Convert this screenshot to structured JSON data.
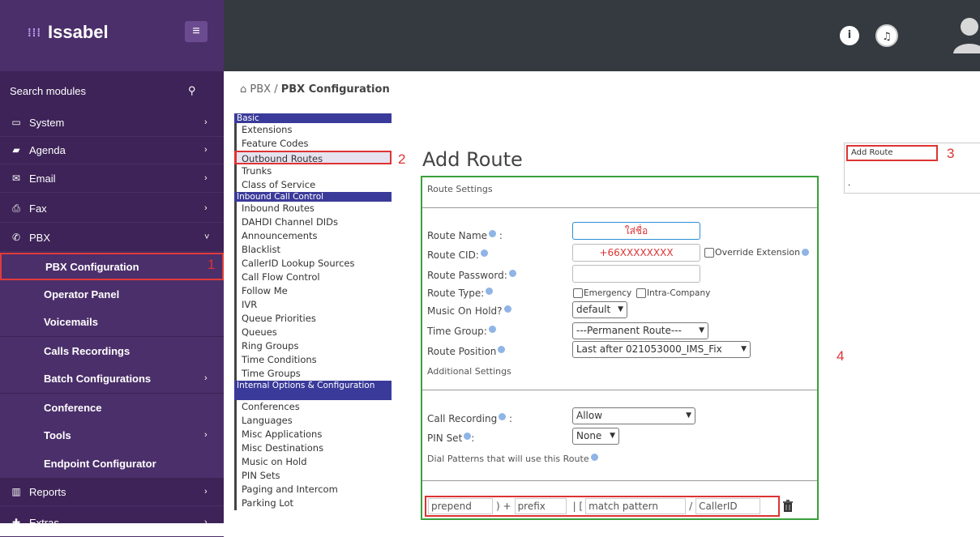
{
  "sidebar": {
    "brand": "Issabel",
    "search_label": "Search modules",
    "items": [
      {
        "label": "System",
        "icon": "monitor-icon",
        "chevron": "›"
      },
      {
        "label": "Agenda",
        "icon": "book-icon",
        "chevron": "›"
      },
      {
        "label": "Email",
        "icon": "envelope-icon",
        "chevron": "›"
      },
      {
        "label": "Fax",
        "icon": "printer-icon",
        "chevron": "›"
      },
      {
        "label": "PBX",
        "icon": "phone-icon",
        "chevron": "˅"
      },
      {
        "label": "PBX Configuration"
      },
      {
        "label": "Operator Panel"
      },
      {
        "label": "Voicemails"
      },
      {
        "label": "Calls Recordings"
      },
      {
        "label": "Batch Configurations",
        "chevron": "›"
      },
      {
        "label": "Conference"
      },
      {
        "label": "Tools",
        "chevron": "›"
      },
      {
        "label": "Endpoint Configurator"
      },
      {
        "label": "Reports",
        "icon": "bar-chart-icon",
        "chevron": "›"
      },
      {
        "label": "Extras",
        "icon": "plus-icon",
        "chevron": "›"
      }
    ]
  },
  "markers": {
    "m1": "1",
    "m2": "2",
    "m3": "3",
    "m4": "4"
  },
  "topbar": {
    "info_glyph": "i",
    "bell_glyph": "♫"
  },
  "breadcrumb": {
    "home_glyph": "⌂",
    "pbx": "PBX",
    "sep": "/",
    "current": "PBX Configuration"
  },
  "pbx_menu": {
    "basic": "Basic",
    "basic_items": [
      "Extensions",
      "Feature Codes",
      "Outbound Routes",
      "Trunks",
      "Class of Service"
    ],
    "inbound": "Inbound Call Control",
    "inbound_items": [
      "Inbound Routes",
      "DAHDI Channel DIDs",
      "Announcements",
      "Blacklist",
      "CallerID Lookup Sources",
      "Call Flow Control",
      "Follow Me",
      "IVR",
      "Queue Priorities",
      "Queues",
      "Ring Groups",
      "Time Conditions",
      "Time Groups"
    ],
    "internal": "Internal Options & Configuration",
    "internal_items": [
      "Conferences",
      "Languages",
      "Misc Applications",
      "Misc Destinations",
      "Music on Hold",
      "PIN Sets",
      "Paging and Intercom",
      "Parking Lot"
    ]
  },
  "form": {
    "title": "Add Route",
    "route_settings": "Route Settings",
    "route_name_label": "Route Name",
    "route_name_value": "ใส่ชื่อ",
    "route_cid_label": "Route CID:",
    "route_cid_value": "+66XXXXXXXX",
    "override_extension": "Override Extension",
    "route_password_label": "Route Password:",
    "route_type_label": "Route Type:",
    "emergency": "Emergency",
    "intra_company": "Intra-Company",
    "music_on_hold_label": "Music On Hold?",
    "music_on_hold_value": "default",
    "time_group_label": "Time Group:",
    "time_group_value": "---Permanent Route---",
    "route_position_label": "Route Position",
    "route_position_value": "Last after 021053000_IMS_Fix",
    "additional_settings": "Additional Settings",
    "call_recording_label": "Call Recording",
    "call_recording_value": "Allow",
    "pin_set_label": "PIN Set",
    "pin_set_value": "None",
    "dial_patterns_label": "Dial Patterns that will use this Route",
    "prepend_placeholder": "prepend",
    "prefix_placeholder": "prefix",
    "match_placeholder": "match pattern",
    "callerid_placeholder": "CallerID",
    "plus_sep": ") +",
    "pipe_sep": "| [",
    "slash_sep": "/"
  },
  "right_panel": {
    "add_route": "Add Route",
    "dot": "."
  },
  "colors": {
    "sidebar": "#3d2357",
    "topbar": "#353a40",
    "accent_red": "#d33",
    "form_border": "#3aa03a"
  }
}
